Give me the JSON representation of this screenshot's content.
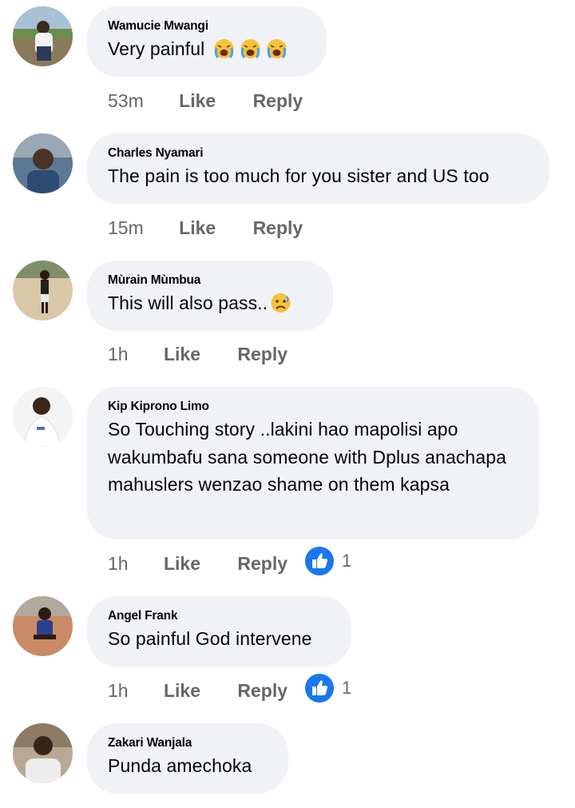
{
  "comments": [
    {
      "author": "Wamucie Mwangi",
      "text": "Very painful",
      "emoji": [
        "crying-face",
        "crying-face",
        "crying-face"
      ],
      "time": "53m",
      "like_label": "Like",
      "reply_label": "Reply"
    },
    {
      "author": "Charles Nyamari",
      "text": "The pain is too much for you sister and US too",
      "time": "15m",
      "like_label": "Like",
      "reply_label": "Reply"
    },
    {
      "author": "Mùrain Mùmbua",
      "text": "This will also pass..",
      "emoji": [
        "worried-face"
      ],
      "time": "1h",
      "like_label": "Like",
      "reply_label": "Reply"
    },
    {
      "author": "Kip Kiprono Limo",
      "text": "So Touching story ..lakini hao mapolisi apo wakumbafu sana someone with Dplus anachapa mahuslers wenzao shame on them kapsa",
      "time": "1h",
      "like_label": "Like",
      "reply_label": "Reply",
      "reaction_count": "1"
    },
    {
      "author": "Angel Frank",
      "text": "So painful God intervene",
      "time": "1h",
      "like_label": "Like",
      "reply_label": "Reply",
      "reaction_count": "1"
    },
    {
      "author": "Zakari Wanjala",
      "text": "Punda amechoka"
    }
  ],
  "colors": {
    "bubble": "#f0f2f5",
    "meta_text": "#65676b",
    "like_blue": "#1877f2"
  }
}
